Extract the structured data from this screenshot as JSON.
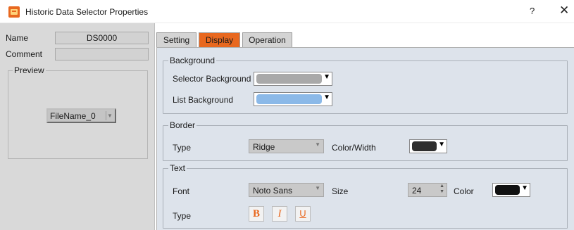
{
  "window": {
    "title": "Historic Data Selector Properties",
    "help_label": "?",
    "close_label": "✕"
  },
  "left_panel": {
    "name_label": "Name",
    "name_value": "DS0000",
    "comment_label": "Comment",
    "comment_value": "",
    "preview": {
      "title": "Preview",
      "combo_text": "FileName_0"
    }
  },
  "tabs": [
    {
      "label": "Setting",
      "active": false
    },
    {
      "label": "Display",
      "active": true
    },
    {
      "label": "Operation",
      "active": false
    }
  ],
  "background_group": {
    "title": "Background",
    "selector_bg_label": "Selector Background",
    "selector_bg_color": "#a9a9a9",
    "list_bg_label": "List Background",
    "list_bg_color": "#8bb9e8"
  },
  "border_group": {
    "title": "Border",
    "type_label": "Type",
    "type_value": "Ridge",
    "color_width_label": "Color/Width",
    "color": "#2e2e2e"
  },
  "text_group": {
    "title": "Text",
    "font_label": "Font",
    "font_value": "Noto Sans",
    "size_label": "Size",
    "size_value": "24",
    "color_label": "Color",
    "color": "#111111",
    "type_label": "Type",
    "bold_label": "B",
    "italic_label": "I",
    "underline_label": "U"
  },
  "colors": {
    "accent": "#e8681f",
    "panel_bg": "#dde3eb",
    "left_bg": "#d9d9d9"
  },
  "icons": {
    "app": "historic-data-selector-icon",
    "dropdown": "triangle-down-icon"
  }
}
